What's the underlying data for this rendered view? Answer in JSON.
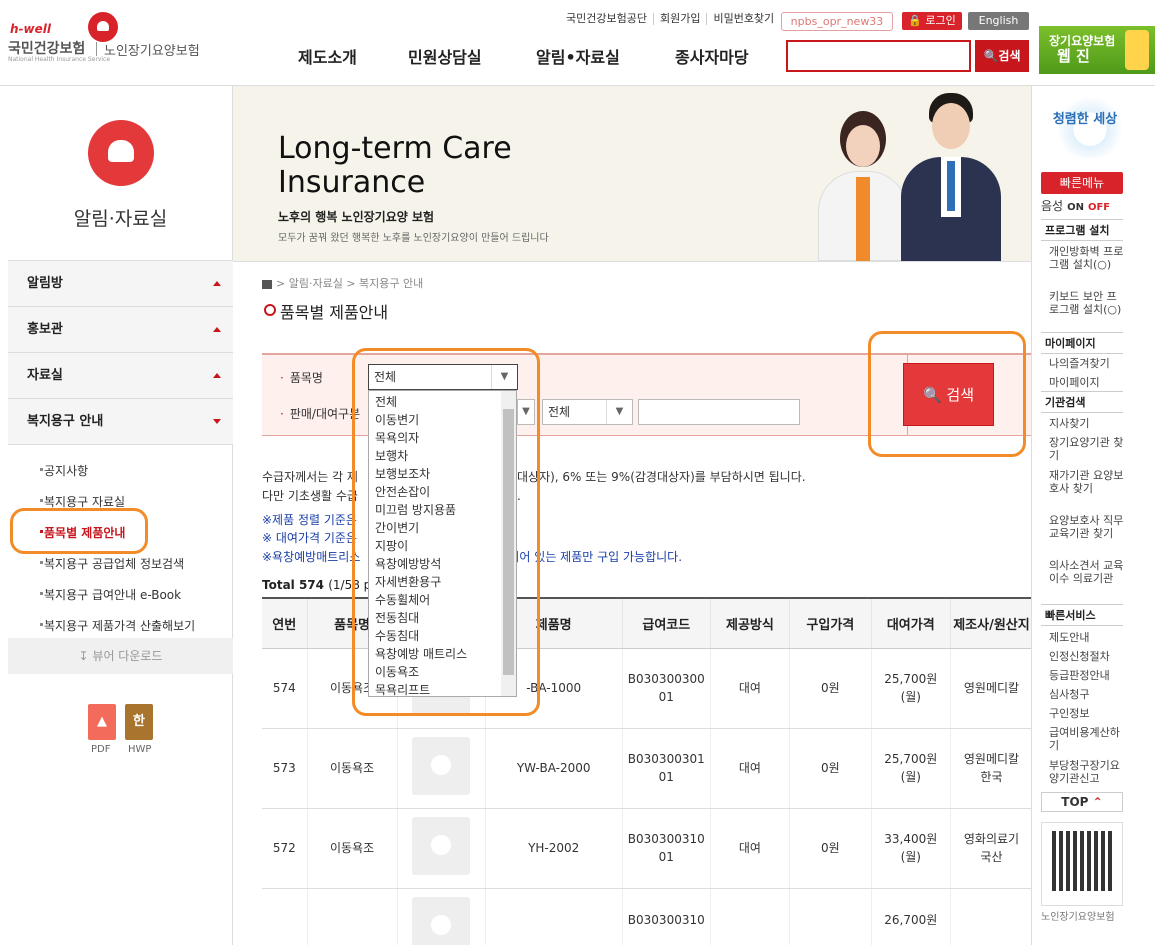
{
  "header": {
    "logo_en": "h-well",
    "logo_kr": "국민건강보험",
    "logo_sub": "노인장기요양보험",
    "logo_tiny": "National Health Insurance Service",
    "top_links": [
      "국민건강보험공단",
      "회원가입",
      "비밀번호찾기"
    ],
    "user_id": "npbs_opr_new33",
    "login": "로그인",
    "english": "English",
    "gnb": [
      "제도소개",
      "민원상담실",
      "알림•자료실",
      "종사자마당"
    ],
    "search_placeholder": "",
    "search_btn": "검색",
    "webzine_line1": "장기요양보험",
    "webzine_line2": "웹 진"
  },
  "lnb": {
    "title": "알림·자료실",
    "menus": [
      "알림방",
      "홍보관",
      "자료실",
      "복지용구 안내"
    ],
    "subs": [
      "공지사항",
      "복지용구 자료실",
      "품목별 제품안내",
      "복지용구 공급업체 정보검색",
      "복지용구 급여안내 e-Book",
      "복지용구 제품가격 산출해보기"
    ],
    "viewer": "뷰어 다운로드",
    "files": [
      {
        "label": "PDF",
        "icon": "pdf-icon",
        "color": "#f26b5b"
      },
      {
        "label": "HWP",
        "icon": "hwp-icon",
        "color": "#a9742e"
      }
    ]
  },
  "banner": {
    "title_line1": "Long-term Care",
    "title_line2": "Insurance",
    "kr": "노후의 행복 노인장기요양 보험",
    "sub": "모두가 꿈꿔 왔던 행복한 노후를 노인장기요양이 만들어 드립니다"
  },
  "breadcrumb": [
    "알림·자료실",
    "복지용구 안내"
  ],
  "page_title": "품목별 제품안내",
  "search": {
    "label_item": "품목명",
    "label_sale": "판매/대여구분",
    "selected": "전체",
    "sale_selected": "전체",
    "btn": "검색",
    "options": [
      "전체",
      "이동변기",
      "목욕의자",
      "보행차",
      "보행보조차",
      "안전손잡이",
      "미끄럼 방지용품",
      "간이변기",
      "지팡이",
      "욕창예방방석",
      "자세변환용구",
      "수동휠체어",
      "전동침대",
      "수동침대",
      "욕창예방 매트리스",
      "이동욕조",
      "목욕리프트"
    ]
  },
  "notices": {
    "line1_a": "수급자께서는 각 제",
    "line1_b": "산대상자), 6% 또는 9%(감경대상자)를 부담하시면 됩니다.",
    "line2_a": "다만 기초생활 수급",
    "line2_b": "다.",
    "blue1": "※제품 정렬 기준은",
    "blue2": "※ 대여가격 기준은",
    "blue3_a": "※욕창예방매트리스",
    "blue3_b": "되어 있는 제품만 구입 가능합니다."
  },
  "total": "Total 574",
  "total_paging": "(1/58 pa",
  "table": {
    "headers": [
      "연번",
      "품목명",
      "",
      "제품명",
      "급여코드",
      "제공방식",
      "구입가격",
      "대여가격",
      "제조사/원산지"
    ],
    "rows": [
      {
        "no": "574",
        "item": "이동욕조",
        "name": "-BA-1000",
        "code1": "B030300300",
        "code2": "01",
        "method": "대여",
        "buy": "0원",
        "rent1": "25,700원",
        "rent2": "(월)",
        "maker1": "영원메디칼",
        "maker2": ""
      },
      {
        "no": "573",
        "item": "이동욕조",
        "name": "YW-BA-2000",
        "code1": "B030300301",
        "code2": "01",
        "method": "대여",
        "buy": "0원",
        "rent1": "25,700원",
        "rent2": "(월)",
        "maker1": "영원메디칼",
        "maker2": "한국"
      },
      {
        "no": "572",
        "item": "이동욕조",
        "name": "YH-2002",
        "code1": "B030300310",
        "code2": "01",
        "method": "대여",
        "buy": "0원",
        "rent1": "33,400원",
        "rent2": "(월)",
        "maker1": "영화의료기",
        "maker2": "국산"
      },
      {
        "no": "",
        "item": "",
        "name": "",
        "code1": "B030300310",
        "code2": "",
        "method": "",
        "buy": "",
        "rent1": "26,700원",
        "rent2": "",
        "maker1": "",
        "maker2": ""
      }
    ]
  },
  "quick": {
    "clean": "청렴한 세상",
    "head": "빠른메뉴",
    "voice": "음성",
    "on": "ON",
    "off": "OFF",
    "sec1": "프로그램 설치",
    "items1": [
      "개인방화벽 프로그램 설치(○)",
      "키보드 보안 프로그램 설치(○)"
    ],
    "sec2": "마이페이지",
    "items2": [
      "나의즐겨찾기",
      "마이페이지"
    ],
    "sec3": "기관검색",
    "items3": [
      "지사찾기",
      "장기요양기관 찾기",
      "재가기관 요양보호사 찾기",
      "요양보호사 직무교육기관 찾기",
      "의사소견서 교육이수 의료기관"
    ],
    "sec4": "빠른서비스",
    "items4": [
      "제도안내",
      "인정신청절차",
      "등급판정안내",
      "심사청구",
      "구인정보",
      "급여비용계산하기",
      "부당청구장기요양기관신고"
    ],
    "top": "TOP",
    "qr_caption": "노인장기요양보험"
  },
  "colors": {
    "brand_red": "#d9232b",
    "highlight_orange": "#f28c28",
    "link_blue": "#1a3fa8"
  }
}
